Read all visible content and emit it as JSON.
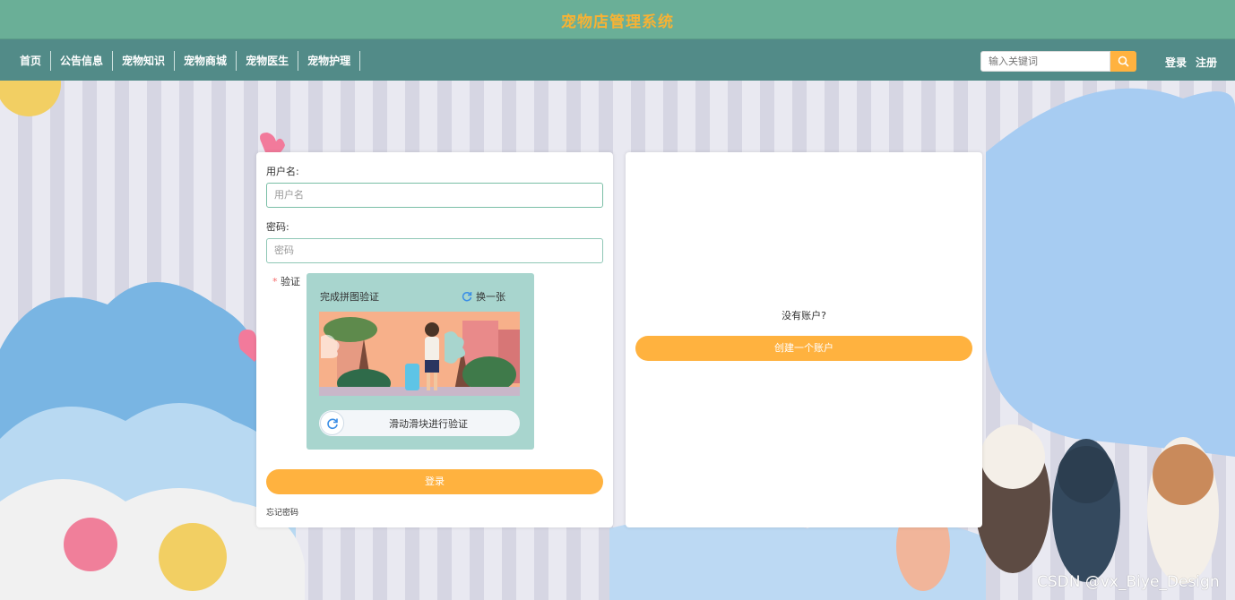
{
  "header": {
    "title": "宠物店管理系统"
  },
  "nav": {
    "items": [
      "首页",
      "公告信息",
      "宠物知识",
      "宠物商城",
      "宠物医生",
      "宠物护理"
    ],
    "search_placeholder": "输入关键词",
    "login": "登录",
    "register": "注册"
  },
  "login_form": {
    "username_label": "用户名:",
    "username_placeholder": "用户名",
    "password_label": "密码:",
    "password_placeholder": "密码",
    "captcha_required_mark": "*",
    "captcha_label": "验证",
    "captcha_title": "完成拼图验证",
    "captcha_refresh": "换一张",
    "slider_text": "滑动滑块进行验证",
    "submit": "登录",
    "forgot": "忘记密码"
  },
  "register_panel": {
    "no_account": "没有账户?",
    "create": "创建一个账户"
  },
  "watermark": "CSDN @vx_Biye_Design",
  "colors": {
    "accent": "#ffb23f",
    "header": "#6aaf97",
    "nav": "#528b88",
    "title": "#f7b234"
  }
}
